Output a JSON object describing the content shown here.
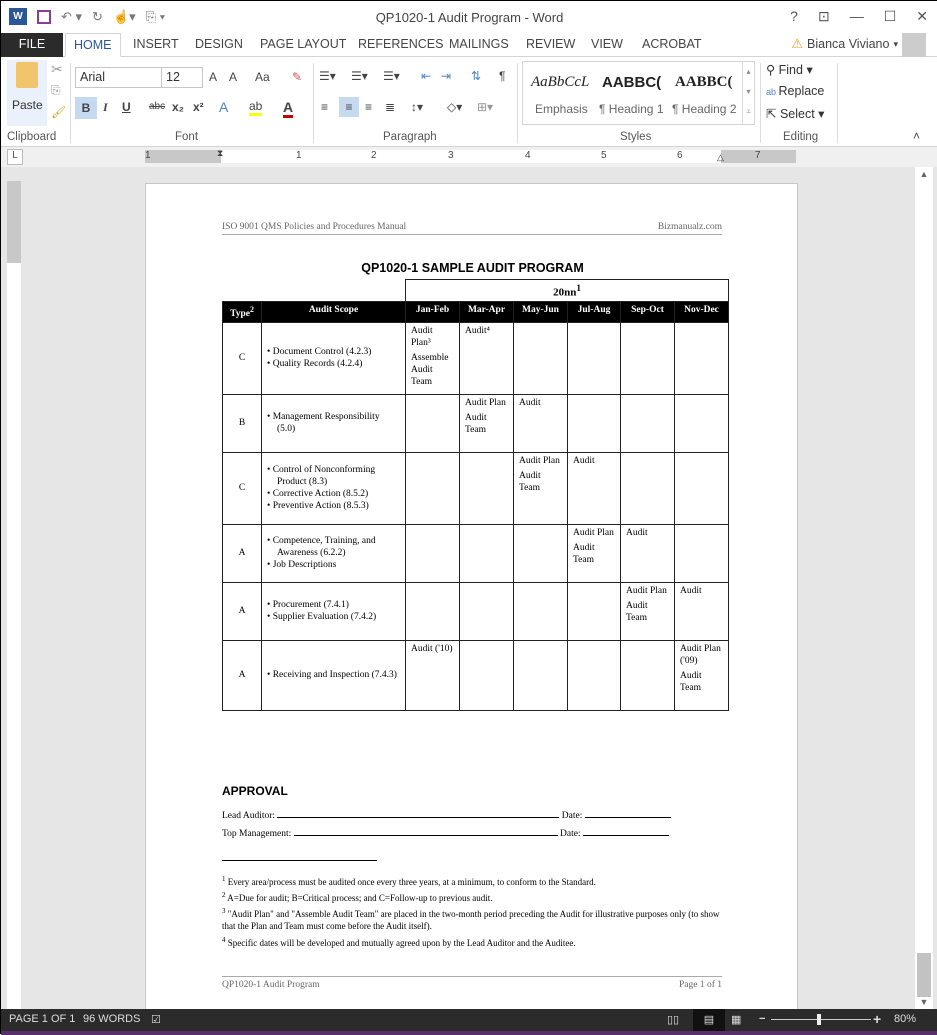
{
  "window": {
    "title": "QP1020-1 Audit Program - Word",
    "controls": [
      "?",
      "restore-ribbon",
      "minimize",
      "maximize",
      "close"
    ],
    "user": "Bianca Viviano"
  },
  "tabs": [
    "FILE",
    "HOME",
    "INSERT",
    "DESIGN",
    "PAGE LAYOUT",
    "REFERENCES",
    "MAILINGS",
    "REVIEW",
    "VIEW",
    "ACROBAT"
  ],
  "active_tab": "HOME",
  "ribbon": {
    "clipboard": {
      "label": "Clipboard",
      "paste": "Paste"
    },
    "font": {
      "label": "Font",
      "name": "Arial",
      "size": "12",
      "grow": "A˄",
      "shrink": "A˅",
      "case": "Aa",
      "bold": "B",
      "italic": "I",
      "underline": "U",
      "strike": "abc",
      "sub": "x₂",
      "sup": "x²"
    },
    "paragraph": {
      "label": "Paragraph"
    },
    "styles": {
      "label": "Styles",
      "items": [
        {
          "sample": "AaBbCcL",
          "name": "Emphasis"
        },
        {
          "sample": "AABBC(",
          "name": "¶ Heading 1"
        },
        {
          "sample": "AABBC(",
          "name": "¶ Heading 2"
        }
      ]
    },
    "editing": {
      "label": "Editing",
      "find": "Find",
      "replace": "Replace",
      "select": "Select"
    }
  },
  "ruler": {
    "numbers": [
      "1",
      "1",
      "2",
      "3",
      "4",
      "5",
      "6",
      "7"
    ]
  },
  "document": {
    "header_left": "ISO 9001 QMS Policies and Procedures Manual",
    "header_right": "Bizmanualz.com",
    "title": "QP1020-1 SAMPLE AUDIT PROGRAM",
    "year": "20nn",
    "year_sup": "1",
    "columns": [
      "Type",
      "Audit Scope",
      "Jan-Feb",
      "Mar-Apr",
      "May-Jun",
      "Jul-Aug",
      "Sep-Oct",
      "Nov-Dec"
    ],
    "type_sup": "2",
    "rows": [
      {
        "type": "C",
        "scope": [
          "Document Control (4.2.3)",
          "Quality Records (4.2.4)"
        ],
        "cells": [
          [
            "Audit Plan³",
            "Assemble Audit Team"
          ],
          [
            "Audit⁴"
          ],
          [],
          [],
          [],
          []
        ]
      },
      {
        "type": "B",
        "scope": [
          "Management Responsibility (5.0)"
        ],
        "cells": [
          [],
          [
            "Audit Plan",
            "Audit Team"
          ],
          [
            "Audit"
          ],
          [],
          [],
          []
        ]
      },
      {
        "type": "C",
        "scope": [
          "Control of Nonconforming Product (8.3)",
          "Corrective Action (8.5.2)",
          "Preventive Action (8.5.3)"
        ],
        "cells": [
          [],
          [],
          [
            "Audit Plan",
            "Audit Team"
          ],
          [
            "Audit"
          ],
          [],
          []
        ]
      },
      {
        "type": "A",
        "scope": [
          "Competence, Training, and Awareness (6.2.2)",
          "Job Descriptions"
        ],
        "cells": [
          [],
          [],
          [],
          [
            "Audit Plan",
            "Audit Team"
          ],
          [
            "Audit"
          ],
          []
        ]
      },
      {
        "type": "A",
        "scope": [
          "Procurement (7.4.1)",
          "Supplier Evaluation (7.4.2)"
        ],
        "cells": [
          [],
          [],
          [],
          [],
          [
            "Audit Plan",
            "Audit Team"
          ],
          [
            "Audit"
          ]
        ]
      },
      {
        "type": "A",
        "scope": [
          "Receiving and Inspection (7.4.3)"
        ],
        "cells": [
          [
            "Audit ('10)"
          ],
          [],
          [],
          [],
          [],
          [
            "Audit Plan ('09)",
            "Audit Team"
          ]
        ]
      }
    ],
    "approval_heading": "APPROVAL",
    "lead_auditor_label": "Lead Auditor:",
    "top_mgmt_label": "Top Management:",
    "date_label": "Date:",
    "footnotes": [
      {
        "n": "1",
        "text": "Every area/process must be audited once every three years, at a minimum, to conform to the Standard."
      },
      {
        "n": "2",
        "text": "A=Due for audit; B=Critical process; and C=Follow-up to previous audit."
      },
      {
        "n": "3",
        "text": "\"Audit Plan\" and \"Assemble Audit Team\" are placed in the two-month period preceding the Audit for illustrative purposes only (to show that the Plan and Team must come before the Audit itself)."
      },
      {
        "n": "4",
        "text": "Specific dates will be developed and mutually agreed upon by the Lead Auditor and the Auditee."
      }
    ],
    "footer_left": "QP1020-1 Audit Program",
    "footer_right": "Page 1 of 1"
  },
  "status": {
    "page": "PAGE 1 OF 1",
    "words": "96 WORDS",
    "zoom": "80%",
    "zoom_minus": "−",
    "zoom_plus": "+"
  }
}
